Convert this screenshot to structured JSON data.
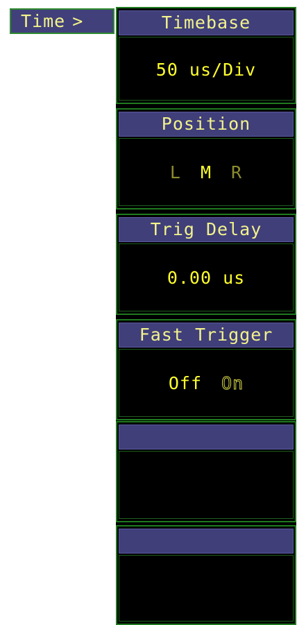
{
  "tab": {
    "label": "Time",
    "chevron": ">"
  },
  "softkeys": [
    {
      "title": "Timebase",
      "value": "50 us/Div"
    },
    {
      "title": "Position",
      "options": [
        "L",
        "M",
        "R"
      ],
      "selected": "M"
    },
    {
      "title": "Trig Delay",
      "value": "0.00 us"
    },
    {
      "title": "Fast Trigger",
      "options": [
        "Off",
        "On"
      ],
      "selected": "Off"
    },
    {
      "title": "",
      "value": ""
    },
    {
      "title": "",
      "value": ""
    }
  ],
  "colors": {
    "header_bg": "#403f7a",
    "border_green": "#1f7a1f",
    "text_yellow": "#f2f28c",
    "value_yellow": "#ffff2e"
  }
}
